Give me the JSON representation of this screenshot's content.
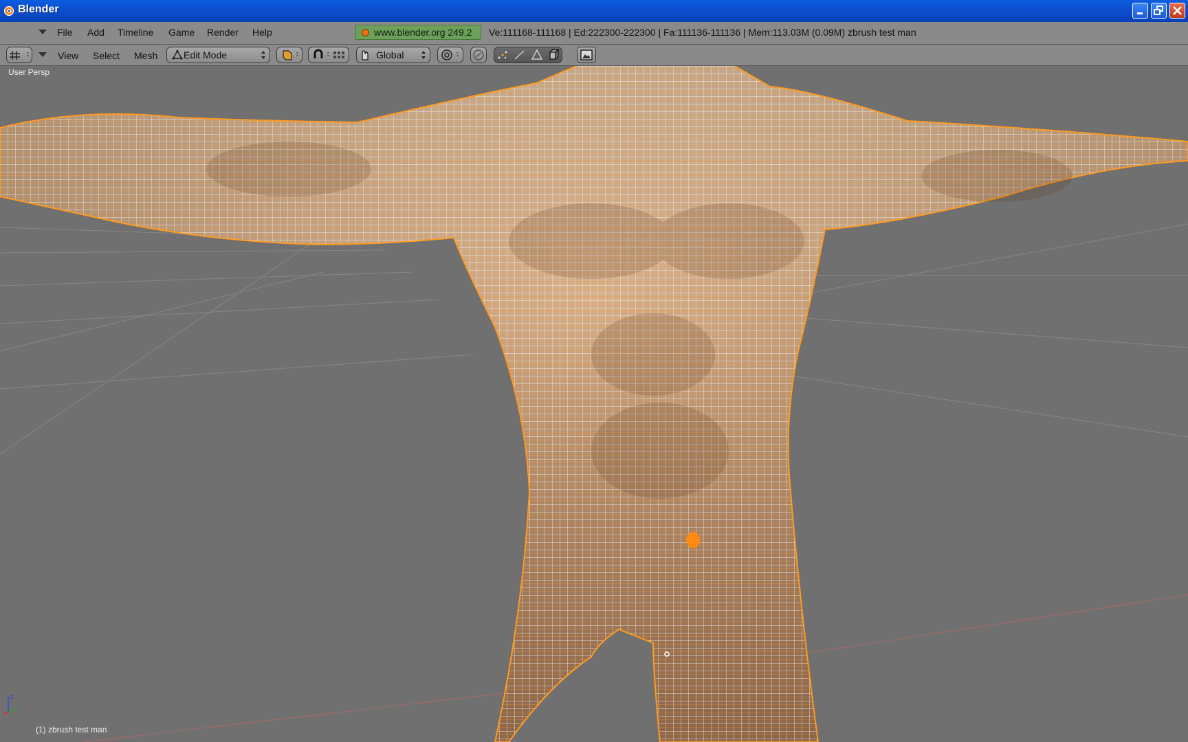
{
  "window": {
    "title": "Blender"
  },
  "menu": {
    "items": [
      {
        "label": "File"
      },
      {
        "label": "Add"
      },
      {
        "label": "Timeline"
      },
      {
        "label": "Game"
      },
      {
        "label": "Render"
      },
      {
        "label": "Help"
      }
    ]
  },
  "info": {
    "url_version": "www.blender.org 249.2",
    "stats": "Ve:111168-111168 | Ed:222300-222300 | Fa:111136-111136 | Mem:113.03M (0.09M) zbrush test man"
  },
  "toolbar": {
    "view_label": "View",
    "select_label": "Select",
    "mesh_label": "Mesh",
    "mode_value": "Edit Mode",
    "orientation_value": "Global"
  },
  "viewport": {
    "view_name": "User Persp",
    "object_label": "(1) zbrush test man"
  },
  "colors": {
    "titlebar": "#0a5ee0",
    "header_bg": "#8a8a8a",
    "viewport_bg": "#707070",
    "wire_selected": "#ff9a20",
    "skin": "#d9b08c"
  },
  "icons": [
    "blender-logo-icon",
    "minimize-icon",
    "restore-icon",
    "close-icon",
    "view3d-editor-icon",
    "draw-type-icon",
    "snap-magnet-icon",
    "transform-manipulator-icon",
    "proportional-edit-icon",
    "vertex-select-icon",
    "edge-select-icon",
    "face-select-icon",
    "occlude-geometry-icon",
    "render-icon"
  ]
}
